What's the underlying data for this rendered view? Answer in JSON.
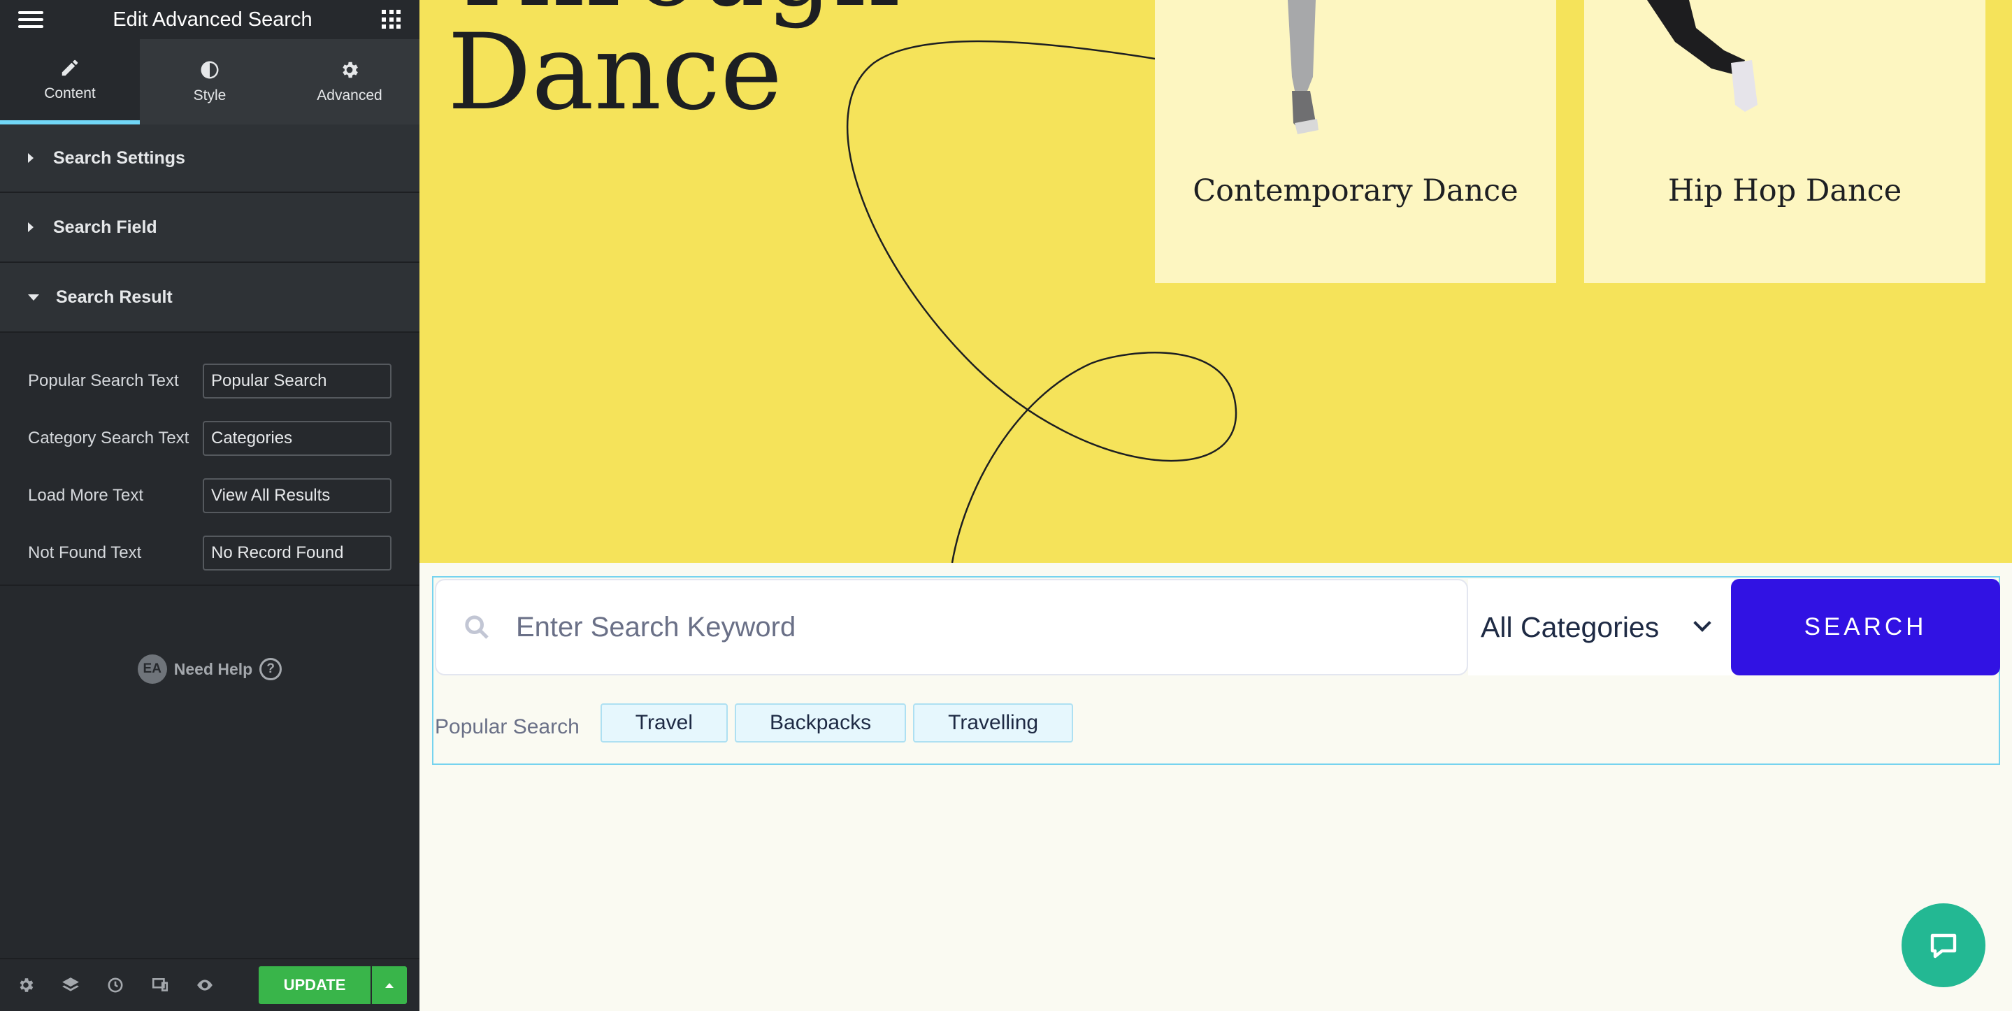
{
  "panel": {
    "title": "Edit Advanced Search",
    "tabs": [
      {
        "label": "Content",
        "icon": "pencil-icon"
      },
      {
        "label": "Style",
        "icon": "half-circle-icon"
      },
      {
        "label": "Advanced",
        "icon": "gear-icon"
      }
    ],
    "sections": {
      "search_settings": "Search Settings",
      "search_field": "Search Field",
      "search_result": "Search Result"
    },
    "fields": [
      {
        "label": "Popular Search Text",
        "value": "Popular Search"
      },
      {
        "label": "Category Search Text",
        "value": "Categories"
      },
      {
        "label": "Load More Text",
        "value": "View All Results"
      },
      {
        "label": "Not Found Text",
        "value": "No Record Found"
      }
    ],
    "help": {
      "badge": "EA",
      "label": "Need Help",
      "icon": "?"
    },
    "footer": {
      "update_label": "UPDATE"
    }
  },
  "hero": {
    "title_line1": "Through",
    "title_line2": "Dance",
    "cards": [
      {
        "label": "Contemporary Dance"
      },
      {
        "label": "Hip Hop Dance"
      }
    ]
  },
  "search": {
    "placeholder": "Enter Search Keyword",
    "category": "All Categories",
    "button": "SEARCH",
    "popular_label": "Popular Search",
    "tags": [
      "Travel",
      "Backpacks",
      "Travelling"
    ]
  },
  "colors": {
    "panel_bg": "#26292d",
    "accent_tab": "#71d7f7",
    "update_green": "#39b54a",
    "hero_yellow": "#f5e35a",
    "card_bg": "#fdf6c1",
    "search_button": "#3112e3",
    "chat_button": "#23b893"
  }
}
